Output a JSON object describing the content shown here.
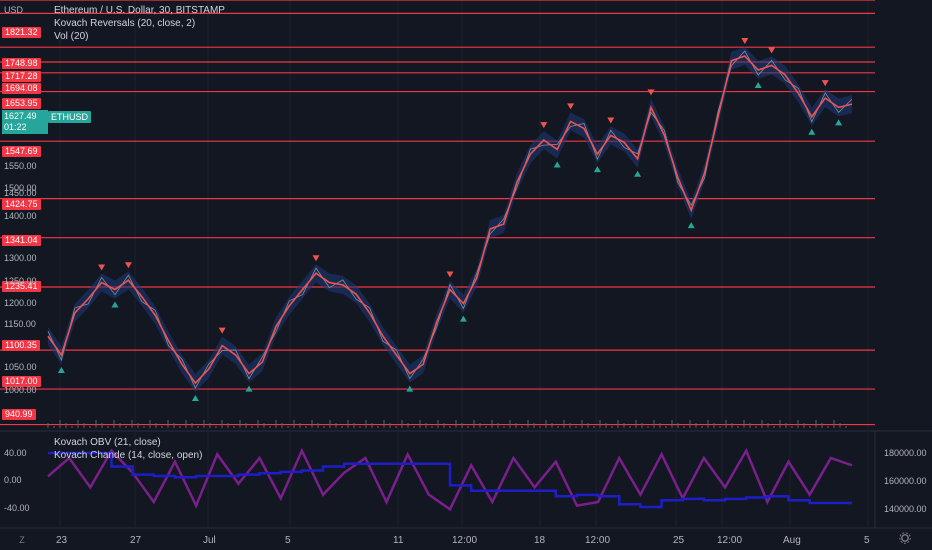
{
  "header": {
    "currency": "USD",
    "symbol_title": "Ethereum / U.S. Dollar, 30, BITSTAMP",
    "indicator_1": "Kovach Reversals (20, close, 2)",
    "indicator_2": "Vol (20)"
  },
  "price_levels": [
    "1821.32",
    "1748.98",
    "1717.28",
    "1694.08",
    "1653.95",
    "1547.69",
    "1424.75",
    "1341.04",
    "1235.41",
    "1100.35",
    "1017.00",
    "940.99"
  ],
  "current": {
    "price": "1627.49",
    "countdown": "01:22",
    "symbol": "ETHUSD"
  },
  "price_axis": [
    "1550.00",
    "1500.00",
    "1450.00",
    "1400.00",
    "1300.00",
    "1250.00",
    "1200.00",
    "1150.00",
    "1050.00",
    "1000.00"
  ],
  "lower_pane": {
    "indicator_1": "Kovach OBV (21, close)",
    "indicator_2": "Kovach Chande (14, close, open)",
    "left_axis": [
      "40.00",
      "0.00",
      "-40.00"
    ],
    "right_axis": [
      "180000.00",
      "160000.00",
      "140000.00"
    ]
  },
  "time_axis": [
    "23",
    "27",
    "Jul",
    "5",
    "11",
    "12:00",
    "18",
    "12:00",
    "25",
    "12:00",
    "Aug",
    "5"
  ],
  "colors": {
    "bg": "#131722",
    "level": "#f23645",
    "up": "#26a69a",
    "down": "#ef5350",
    "obv": "#1e1ec8",
    "chande": "#7b1f8c"
  },
  "icons": {
    "z_button": "Z",
    "gear": "gear-icon"
  },
  "chart_data": {
    "type": "line",
    "price_series_close": [
      1130,
      1090,
      1180,
      1210,
      1245,
      1230,
      1250,
      1215,
      1175,
      1120,
      1070,
      1030,
      1060,
      1110,
      1090,
      1050,
      1075,
      1150,
      1195,
      1230,
      1265,
      1245,
      1240,
      1220,
      1180,
      1130,
      1090,
      1050,
      1070,
      1160,
      1230,
      1200,
      1255,
      1360,
      1370,
      1460,
      1520,
      1550,
      1530,
      1590,
      1575,
      1520,
      1560,
      1545,
      1510,
      1620,
      1560,
      1470,
      1400,
      1480,
      1600,
      1720,
      1730,
      1700,
      1710,
      1690,
      1650,
      1600,
      1640,
      1620,
      1627
    ],
    "obv_series": [
      180,
      180,
      180,
      170,
      164,
      163,
      162,
      163,
      163,
      164,
      165,
      166,
      167,
      170,
      172,
      172,
      172,
      172,
      172,
      156,
      152,
      152,
      152,
      152,
      148,
      149,
      148,
      142,
      140,
      145,
      146,
      145,
      146,
      147,
      148,
      145,
      143,
      143,
      143
    ],
    "chande_series": [
      5,
      30,
      -10,
      40,
      10,
      -30,
      25,
      -35,
      35,
      -5,
      30,
      -25,
      40,
      -20,
      10,
      30,
      -30,
      35,
      -20,
      -40,
      20,
      -30,
      30,
      -10,
      25,
      -35,
      -30,
      30,
      -20,
      35,
      -25,
      30,
      -10,
      40,
      -30,
      25,
      -20,
      30,
      20
    ],
    "price_range": [
      940,
      1850
    ],
    "indicator_range": [
      -60,
      60
    ]
  }
}
